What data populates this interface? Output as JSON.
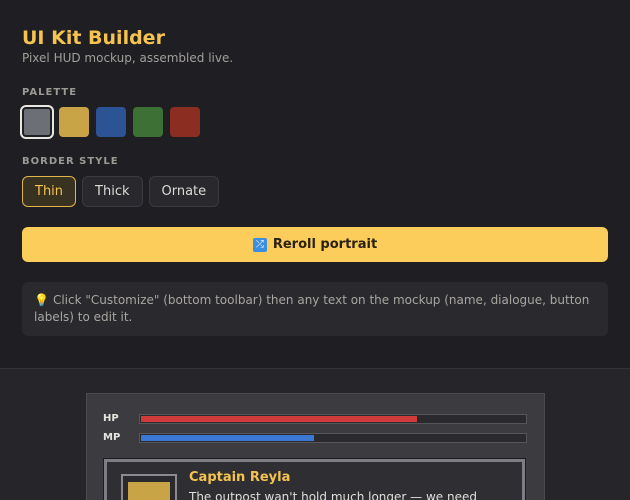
{
  "header": {
    "title": "UI Kit Builder",
    "subtitle": "Pixel HUD mockup, assembled live."
  },
  "palette": {
    "label": "PALETTE",
    "swatches": [
      {
        "name": "gray",
        "color": "#6d6f76",
        "selected": true
      },
      {
        "name": "gold",
        "color": "#c9a446"
      },
      {
        "name": "blue",
        "color": "#2c5494"
      },
      {
        "name": "green",
        "color": "#3c7034"
      },
      {
        "name": "red",
        "color": "#8c2d22"
      }
    ]
  },
  "border_style": {
    "label": "BORDER STYLE",
    "options": [
      "Thin",
      "Thick",
      "Ornate"
    ],
    "selected": "Thin"
  },
  "reroll": {
    "icon": "shuffle-icon",
    "label": "Reroll portrait"
  },
  "tip": {
    "icon": "lightbulb-icon",
    "text": "Click \"Customize\" (bottom toolbar) then any text on the mockup (name, dialogue, button labels) to edit it."
  },
  "hud": {
    "hp": {
      "label": "HP",
      "fraction": 0.72,
      "color": "#d13a3a"
    },
    "mp": {
      "label": "MP",
      "fraction": 0.45,
      "color": "#3a78d4"
    },
    "dialog": {
      "name": "Captain Reyla",
      "line": "The outpost wan't hold much longer — we need"
    }
  },
  "colors": {
    "accent": "#fdcd5b",
    "title": "#f5c34f"
  }
}
